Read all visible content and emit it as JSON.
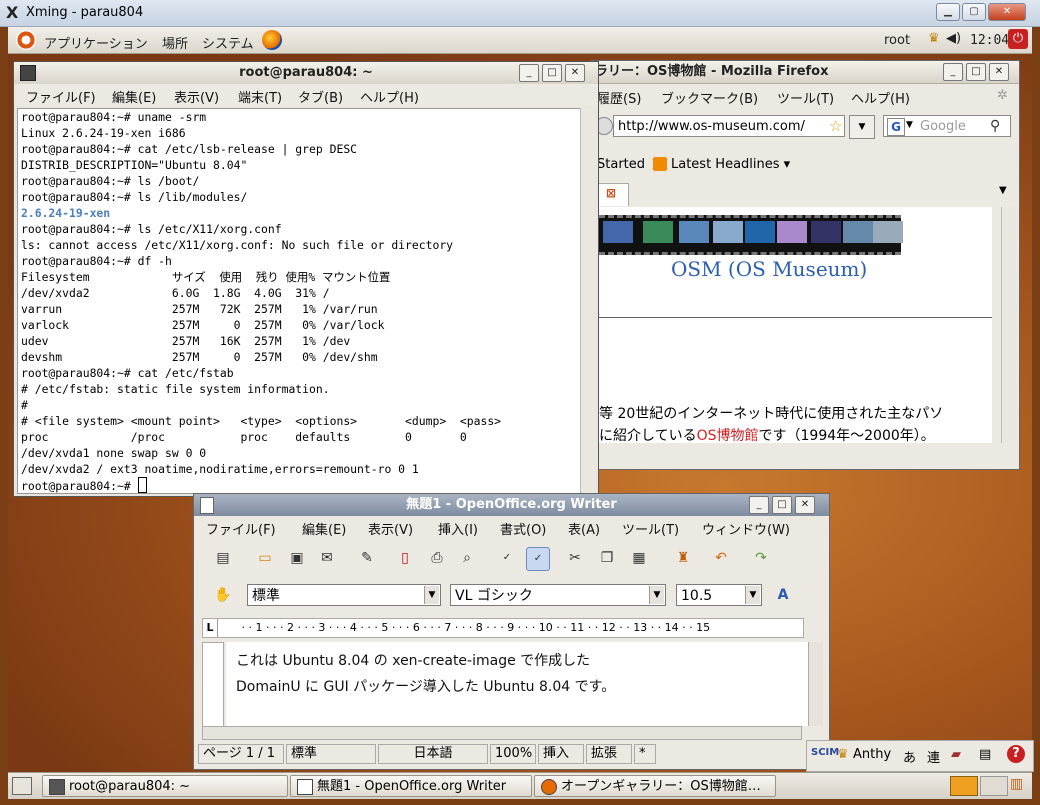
{
  "xming": {
    "title": "Xming - parau804",
    "logo": "X"
  },
  "panel": {
    "menu_applications": "アプリケーション",
    "menu_places": "場所",
    "menu_system": "システム",
    "user": "root",
    "clock": "12:04"
  },
  "terminal": {
    "title": "root@parau804: ~",
    "menu": [
      "ファイル(F)",
      "編集(E)",
      "表示(V)",
      "端末(T)",
      "タブ(B)",
      "ヘルプ(H)"
    ],
    "lines": [
      "root@parau804:~# uname -srm",
      "Linux 2.6.24-19-xen i686",
      "root@parau804:~# cat /etc/lsb-release | grep DESC",
      "DISTRIB_DESCRIPTION=\"Ubuntu 8.04\"",
      "root@parau804:~# ls /boot/",
      "root@parau804:~# ls /lib/modules/",
      "2.6.24-19-xen",
      "root@parau804:~# ls /etc/X11/xorg.conf",
      "ls: cannot access /etc/X11/xorg.conf: No such file or directory",
      "root@parau804:~# df -h",
      "Filesystem            サイズ  使用  残り 使用% マウント位置",
      "/dev/xvda2            6.0G  1.8G  4.0G  31% /",
      "varrun                257M   72K  257M   1% /var/run",
      "varlock               257M     0  257M   0% /var/lock",
      "udev                  257M   16K  257M   1% /dev",
      "devshm                257M     0  257M   0% /dev/shm",
      "root@parau804:~# cat /etc/fstab",
      "# /etc/fstab: static file system information.",
      "#",
      "# <file system> <mount point>   <type>  <options>       <dump>  <pass>",
      "proc            /proc           proc    defaults        0       0",
      "/dev/xvda1 none swap sw 0 0",
      "/dev/xvda2 / ext3 noatime,nodiratime,errors=remount-ro 0 1"
    ],
    "prompt": "root@parau804:~# "
  },
  "firefox": {
    "title": "ラリー：OS博物館 - Mozilla Firefox",
    "menu": [
      "履歴(S)",
      "ブックマーク(B)",
      "ツール(T)",
      "ヘルプ(H)"
    ],
    "url": "http://www.os-museum.com/",
    "search_placeholder": "Google",
    "bookmarks": [
      "Started",
      "Latest Headlines"
    ],
    "site_title": "OSM (OS Museum)",
    "text_line1": "等 20世紀のインターネット時代に使用された主なパソ",
    "text_line2a": "に紹介している",
    "text_link": "OS博物館",
    "text_line2b": "です（1994年〜2000年）。"
  },
  "writer": {
    "title": "無題1 - OpenOffice.org Writer",
    "menu": [
      "ファイル(F)",
      "編集(E)",
      "表示(V)",
      "挿入(I)",
      "書式(O)",
      "表(A)",
      "ツール(T)",
      "ウィンドウ(W)"
    ],
    "style": "標準",
    "font": "VL ゴシック",
    "size": "10.5",
    "ruler": "· · 1 · · · 2 · · · 3 · · · 4 · · · 5 · · · 6 · · · 7 · · · 8 · · · 9 · · · 10 · · 11 · · 12 · · 13 · · 14 · · 15",
    "doc_line1": "これは Ubuntu 8.04 の xen-create-image で作成した",
    "doc_line2": "DomainU に GUI パッケージ導入した Ubuntu 8.04 です。",
    "status": [
      "ページ 1 / 1",
      "標準",
      "日本語",
      "100%",
      "挿入",
      "拡張",
      "*"
    ]
  },
  "im_tray": {
    "label": "Anthy",
    "mode1": "あ",
    "mode2": "連"
  },
  "taskbar": {
    "tasks": [
      "root@parau804: ~",
      "無題1 - OpenOffice.org Writer",
      "オープンギャラリー：OS博物館…"
    ]
  },
  "colors": {
    "ubuntu_orange": "#dd5511",
    "link_red": "#d02020"
  }
}
